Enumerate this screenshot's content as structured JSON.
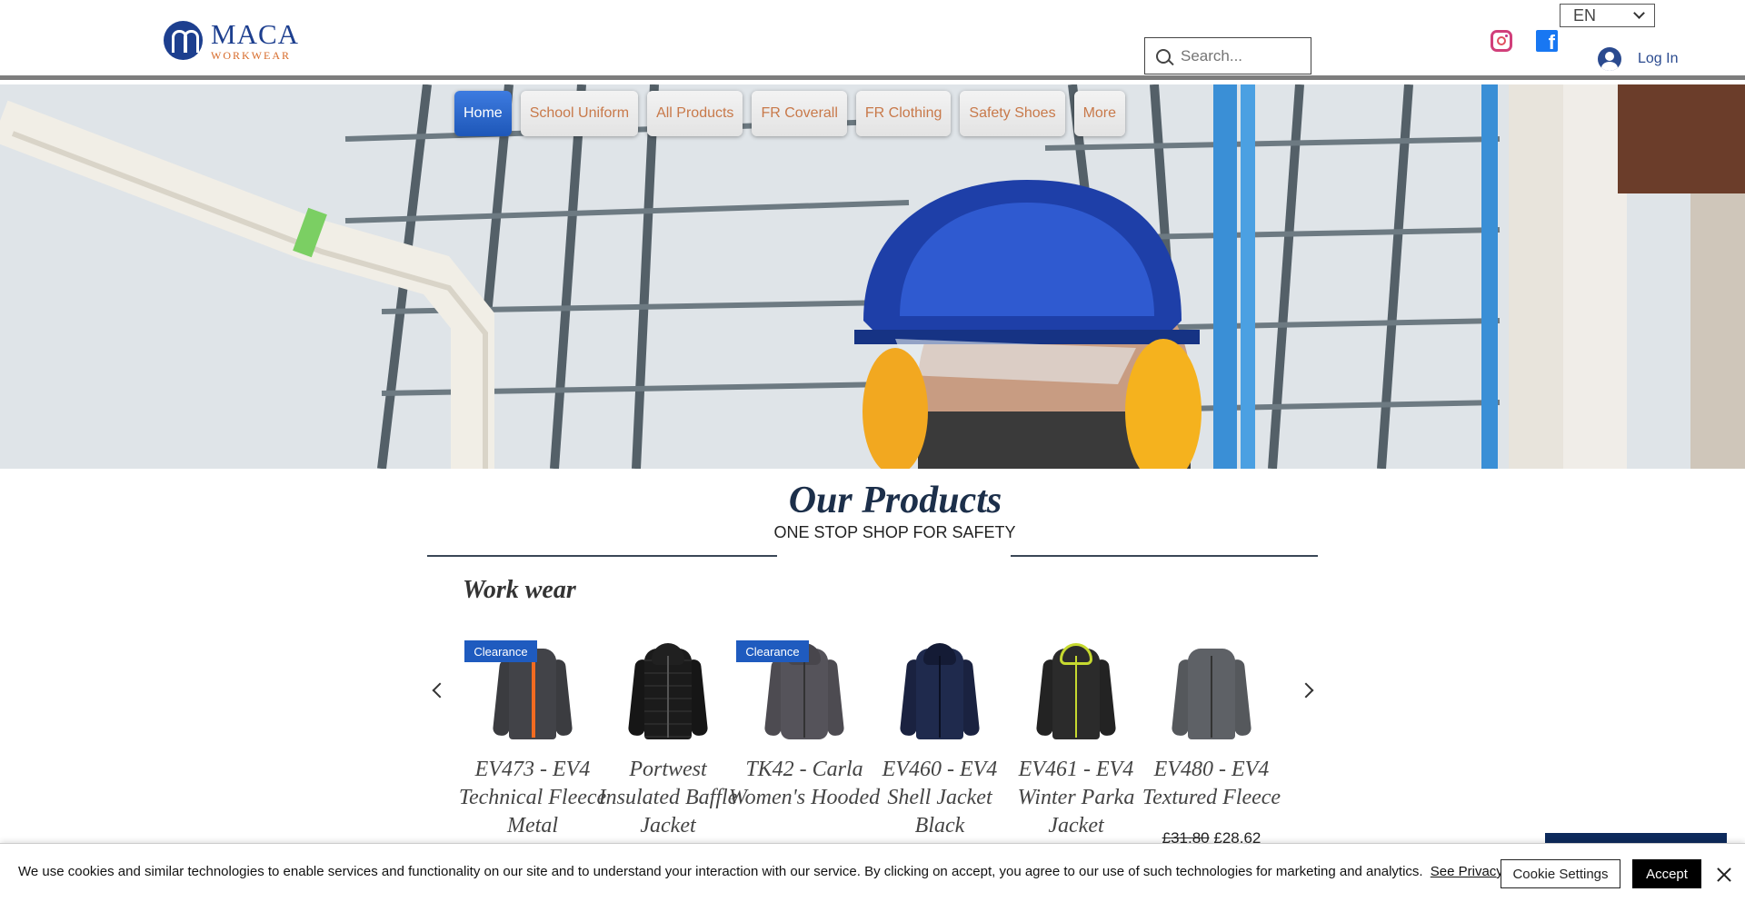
{
  "header": {
    "logo": {
      "name": "MACA",
      "sub": "WORKWEAR"
    },
    "search": {
      "placeholder": "Search..."
    },
    "language": {
      "selected": "EN"
    },
    "social": {
      "instagram": "instagram-icon",
      "facebook": "facebook-icon"
    },
    "login_label": "Log In"
  },
  "nav": {
    "items": [
      {
        "label": "Home",
        "active": true
      },
      {
        "label": "School Uniform"
      },
      {
        "label": "All Products"
      },
      {
        "label": "FR Coverall"
      },
      {
        "label": "FR Clothing"
      },
      {
        "label": "Safety Shoes"
      },
      {
        "label": "More"
      }
    ]
  },
  "products": {
    "title": "Our Products",
    "subtitle": "ONE STOP SHOP FOR SAFETY",
    "section_title": "Work wear",
    "items": [
      {
        "name": "EV473 - EV4 Technical Fleece Metal",
        "badge": "Clearance",
        "price": ""
      },
      {
        "name": "Portwest Insulated Baffle Jacket",
        "badge": "",
        "price": ""
      },
      {
        "name": "TK42 - Carla Women's Hooded",
        "badge": "Clearance",
        "price": ""
      },
      {
        "name": "EV460 - EV4 Shell Jacket Black",
        "badge": "",
        "price": ""
      },
      {
        "name": "EV461 - EV4 Winter Parka Jacket",
        "badge": "",
        "price": ""
      },
      {
        "name": "EV480 - EV4 Textured Fleece",
        "badge": "",
        "old_price": "£31.80",
        "price": "£28.62"
      }
    ]
  },
  "cookie": {
    "text": "We use cookies and similar technologies to enable services and functionality on our site and to understand your interaction with our service. By clicking on accept, you agree to our use of such technologies for marketing and analytics.",
    "policy_link": "See Privacy Policy",
    "settings_label": "Cookie Settings",
    "accept_label": "Accept"
  },
  "colors": {
    "brand": "#1d3f8f",
    "accent": "#d76a28",
    "nav_active": "#1e57b8",
    "badge": "#1f5bbf"
  }
}
